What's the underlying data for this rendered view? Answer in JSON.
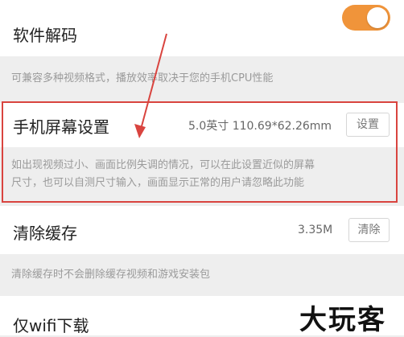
{
  "settings": {
    "decode": {
      "title": "软件解码",
      "toggle_on": true,
      "description": "可兼容多种视频格式，播放效率取决于您的手机CPU性能"
    },
    "screen": {
      "title": "手机屏幕设置",
      "value": "5.0英寸 110.69*62.26mm",
      "button_label": "设置",
      "description_line1": "如出现视频过小、画面比例失调的情况，可以在此设置近似的屏幕",
      "description_line2": "尺寸，也可以自测尺寸输入，画面显示正常的用户请忽略此功能"
    },
    "cache": {
      "title": "清除缓存",
      "value": "3.35M",
      "button_label": "清除",
      "description": "清除缓存时不会删除缓存视频和游戏安装包"
    },
    "wifi": {
      "title": "仅wifi下载"
    }
  },
  "watermark": "大玩客",
  "colors": {
    "accent": "#f0943a",
    "highlight": "#d9443f"
  }
}
